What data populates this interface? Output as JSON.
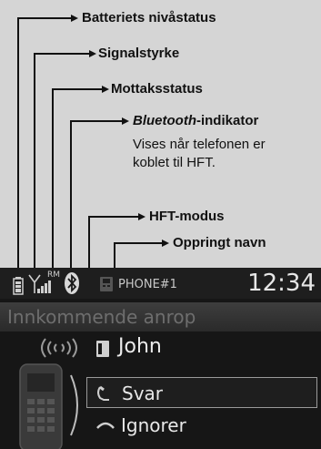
{
  "callouts": {
    "battery": "Batteriets nivåstatus",
    "signal": "Signalstyrke",
    "roam": "Mottaksstatus",
    "bluetooth_italic": "Bluetooth",
    "bluetooth_rest": "-indikator",
    "bluetooth_desc_line1": "Vises når telefonen er",
    "bluetooth_desc_line2": "koblet til HFT.",
    "hft_mode": "HFT-modus",
    "caller": "Oppringt navn"
  },
  "screen": {
    "roam_label": "RM",
    "phone_name": "PHONE#1",
    "clock": "12:34",
    "incoming_label": "Innkommende anrop",
    "caller_name": "John",
    "menu": [
      {
        "label": "Svar",
        "icon": "answer-handset-icon",
        "selected": true
      },
      {
        "label": "Ignorer",
        "icon": "hang-up-handset-icon",
        "selected": false
      }
    ]
  },
  "colors": {
    "background": "#d5d5d5",
    "screen": "#161616",
    "text_light": "#e8e8e8",
    "leader_line": "#111111"
  }
}
